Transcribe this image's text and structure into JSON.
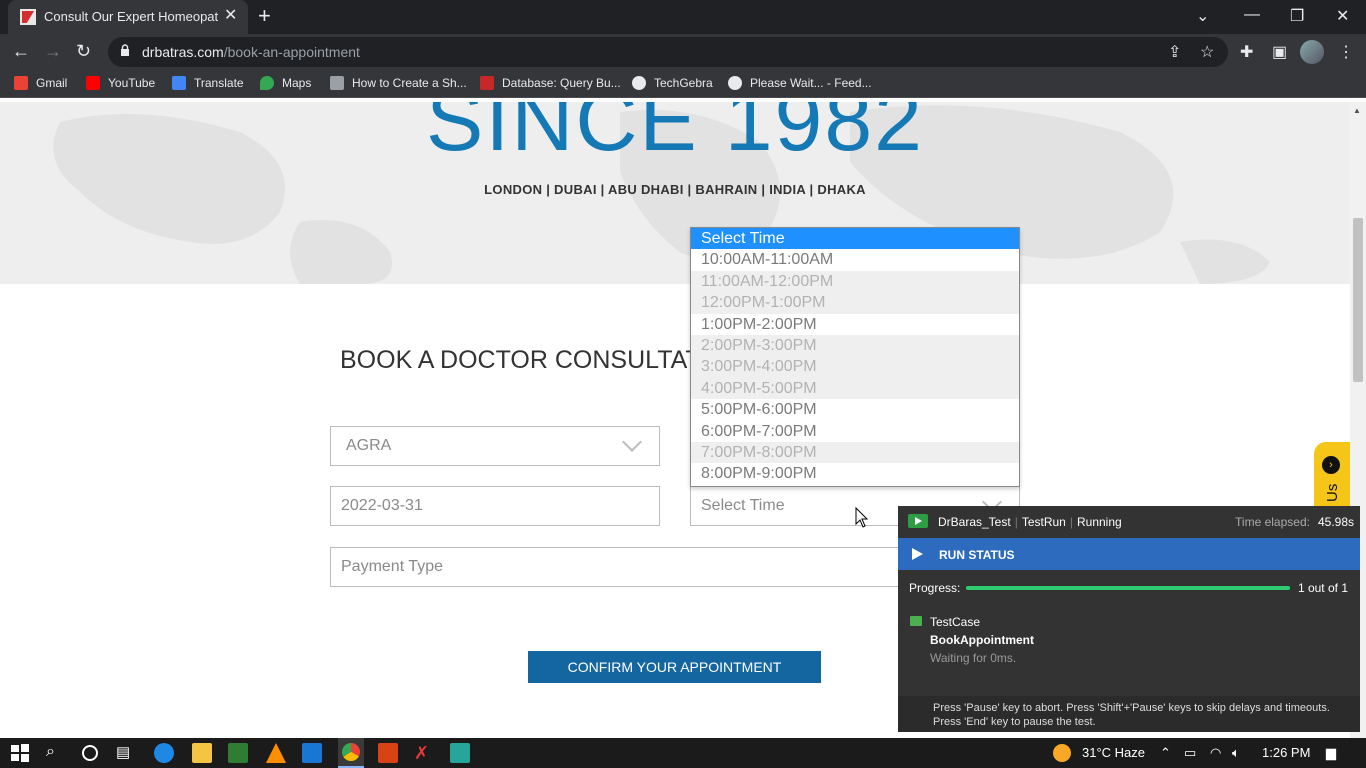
{
  "browser": {
    "tab_title": "Consult Our Expert Homeopathy",
    "url_host": "drbatras.com",
    "url_path": "/book-an-appointment",
    "bookmarks": [
      {
        "label": "Gmail",
        "color": "#ea4335"
      },
      {
        "label": "YouTube",
        "color": "#ff0000"
      },
      {
        "label": "Translate",
        "color": "#4285f4"
      },
      {
        "label": "Maps",
        "color": "#34a853"
      },
      {
        "label": "How to Create a Sh...",
        "color": "#9aa0a6"
      },
      {
        "label": "Database: Query Bu...",
        "color": "#c62828"
      },
      {
        "label": "TechGebra",
        "color": "#e8eaed"
      },
      {
        "label": "Please Wait... - Feed...",
        "color": "#e8eaed"
      }
    ]
  },
  "hero": {
    "since": "SINCE 1982",
    "cities": "LONDON | DUBAI | ABU DHABI | BAHRAIN | INDIA | DHAKA"
  },
  "form": {
    "title": "BOOK A DOCTOR CONSULTATION",
    "city_value": "AGRA",
    "date_value": "2022-03-31",
    "time_placeholder": "Select Time",
    "payment_placeholder": "Payment Type",
    "confirm_label": "CONFIRM YOUR APPOINTMENT",
    "contact_tab": "Us"
  },
  "time_dropdown": {
    "options": [
      {
        "label": "Select Time",
        "state": "selected"
      },
      {
        "label": "10:00AM-11:00AM",
        "state": "enabled"
      },
      {
        "label": "11:00AM-12:00PM",
        "state": "disabled"
      },
      {
        "label": "12:00PM-1:00PM",
        "state": "disabled"
      },
      {
        "label": "1:00PM-2:00PM",
        "state": "enabled"
      },
      {
        "label": "2:00PM-3:00PM",
        "state": "disabled"
      },
      {
        "label": "3:00PM-4:00PM",
        "state": "disabled"
      },
      {
        "label": "4:00PM-5:00PM",
        "state": "disabled"
      },
      {
        "label": "5:00PM-6:00PM",
        "state": "enabled"
      },
      {
        "label": "6:00PM-7:00PM",
        "state": "enabled"
      },
      {
        "label": "7:00PM-8:00PM",
        "state": "disabled"
      },
      {
        "label": "8:00PM-9:00PM",
        "state": "enabled"
      }
    ]
  },
  "run_panel": {
    "project": "DrBaras_Test",
    "mode": "TestRun",
    "status": "Running",
    "elapsed_label": "Time elapsed:",
    "elapsed_value": "45.98s",
    "header": "RUN STATUS",
    "progress_label": "Progress:",
    "progress_fraction": 1.0,
    "progress_count": "1 out of 1",
    "testcase_label": "TestCase",
    "testcase_name": "BookAppointment",
    "waiting": "Waiting for 0ms.",
    "footer_line1": "Press 'Pause' key to abort. Press 'Shift'+'Pause' keys to skip delays and timeouts.",
    "footer_line2": "Press 'End' key to pause the test."
  },
  "taskbar": {
    "weather": "31°C  Haze",
    "time": "1:26 PM"
  }
}
